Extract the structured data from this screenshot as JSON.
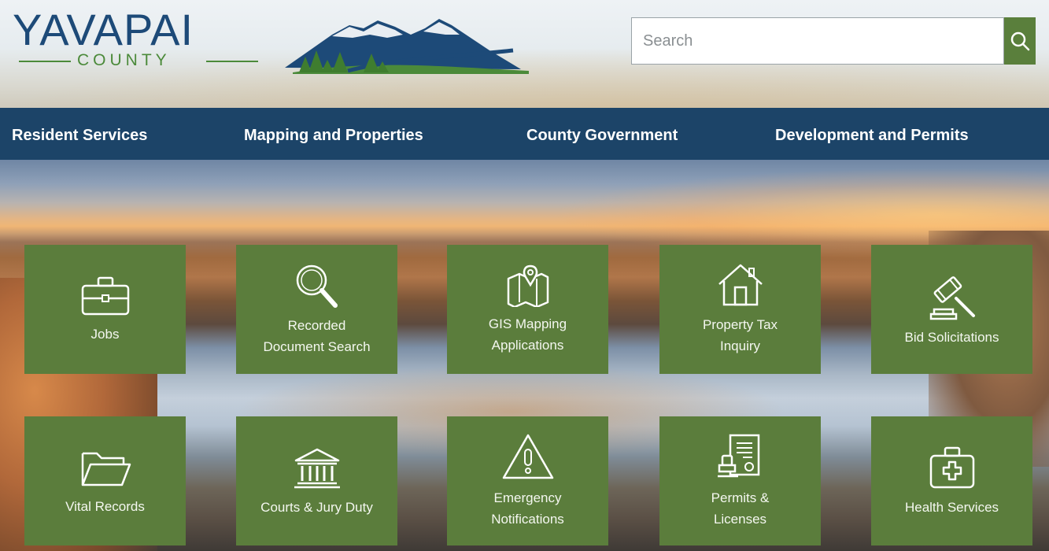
{
  "header": {
    "logo_word": "YAVAPAI",
    "logo_sub": "COUNTY",
    "search": {
      "placeholder": "Search",
      "value": ""
    }
  },
  "nav": {
    "items": [
      {
        "label": "Resident Services"
      },
      {
        "label": "Mapping and Properties"
      },
      {
        "label": "County Government"
      },
      {
        "label": "Development and Permits"
      }
    ]
  },
  "tiles": [
    {
      "label": "Jobs",
      "icon": "briefcase-icon"
    },
    {
      "label": "Recorded\nDocument Search",
      "icon": "magnifier-icon"
    },
    {
      "label": "GIS Mapping\nApplications",
      "icon": "map-pin-icon"
    },
    {
      "label": "Property Tax\nInquiry",
      "icon": "house-icon"
    },
    {
      "label": "Bid Solicitations",
      "icon": "gavel-icon"
    },
    {
      "label": "Vital Records",
      "icon": "folder-icon"
    },
    {
      "label": "Courts & Jury Duty",
      "icon": "courthouse-icon"
    },
    {
      "label": "Emergency\nNotifications",
      "icon": "warning-icon"
    },
    {
      "label": "Permits &\nLicenses",
      "icon": "permit-document-icon"
    },
    {
      "label": "Health Services",
      "icon": "first-aid-kit-icon"
    }
  ],
  "colors": {
    "nav_bg": "#1c4468",
    "tile_bg": "#5b7d3c",
    "logo_blue": "#1d4a78",
    "logo_green": "#4b8a3a",
    "search_button": "#5a7f3c"
  }
}
